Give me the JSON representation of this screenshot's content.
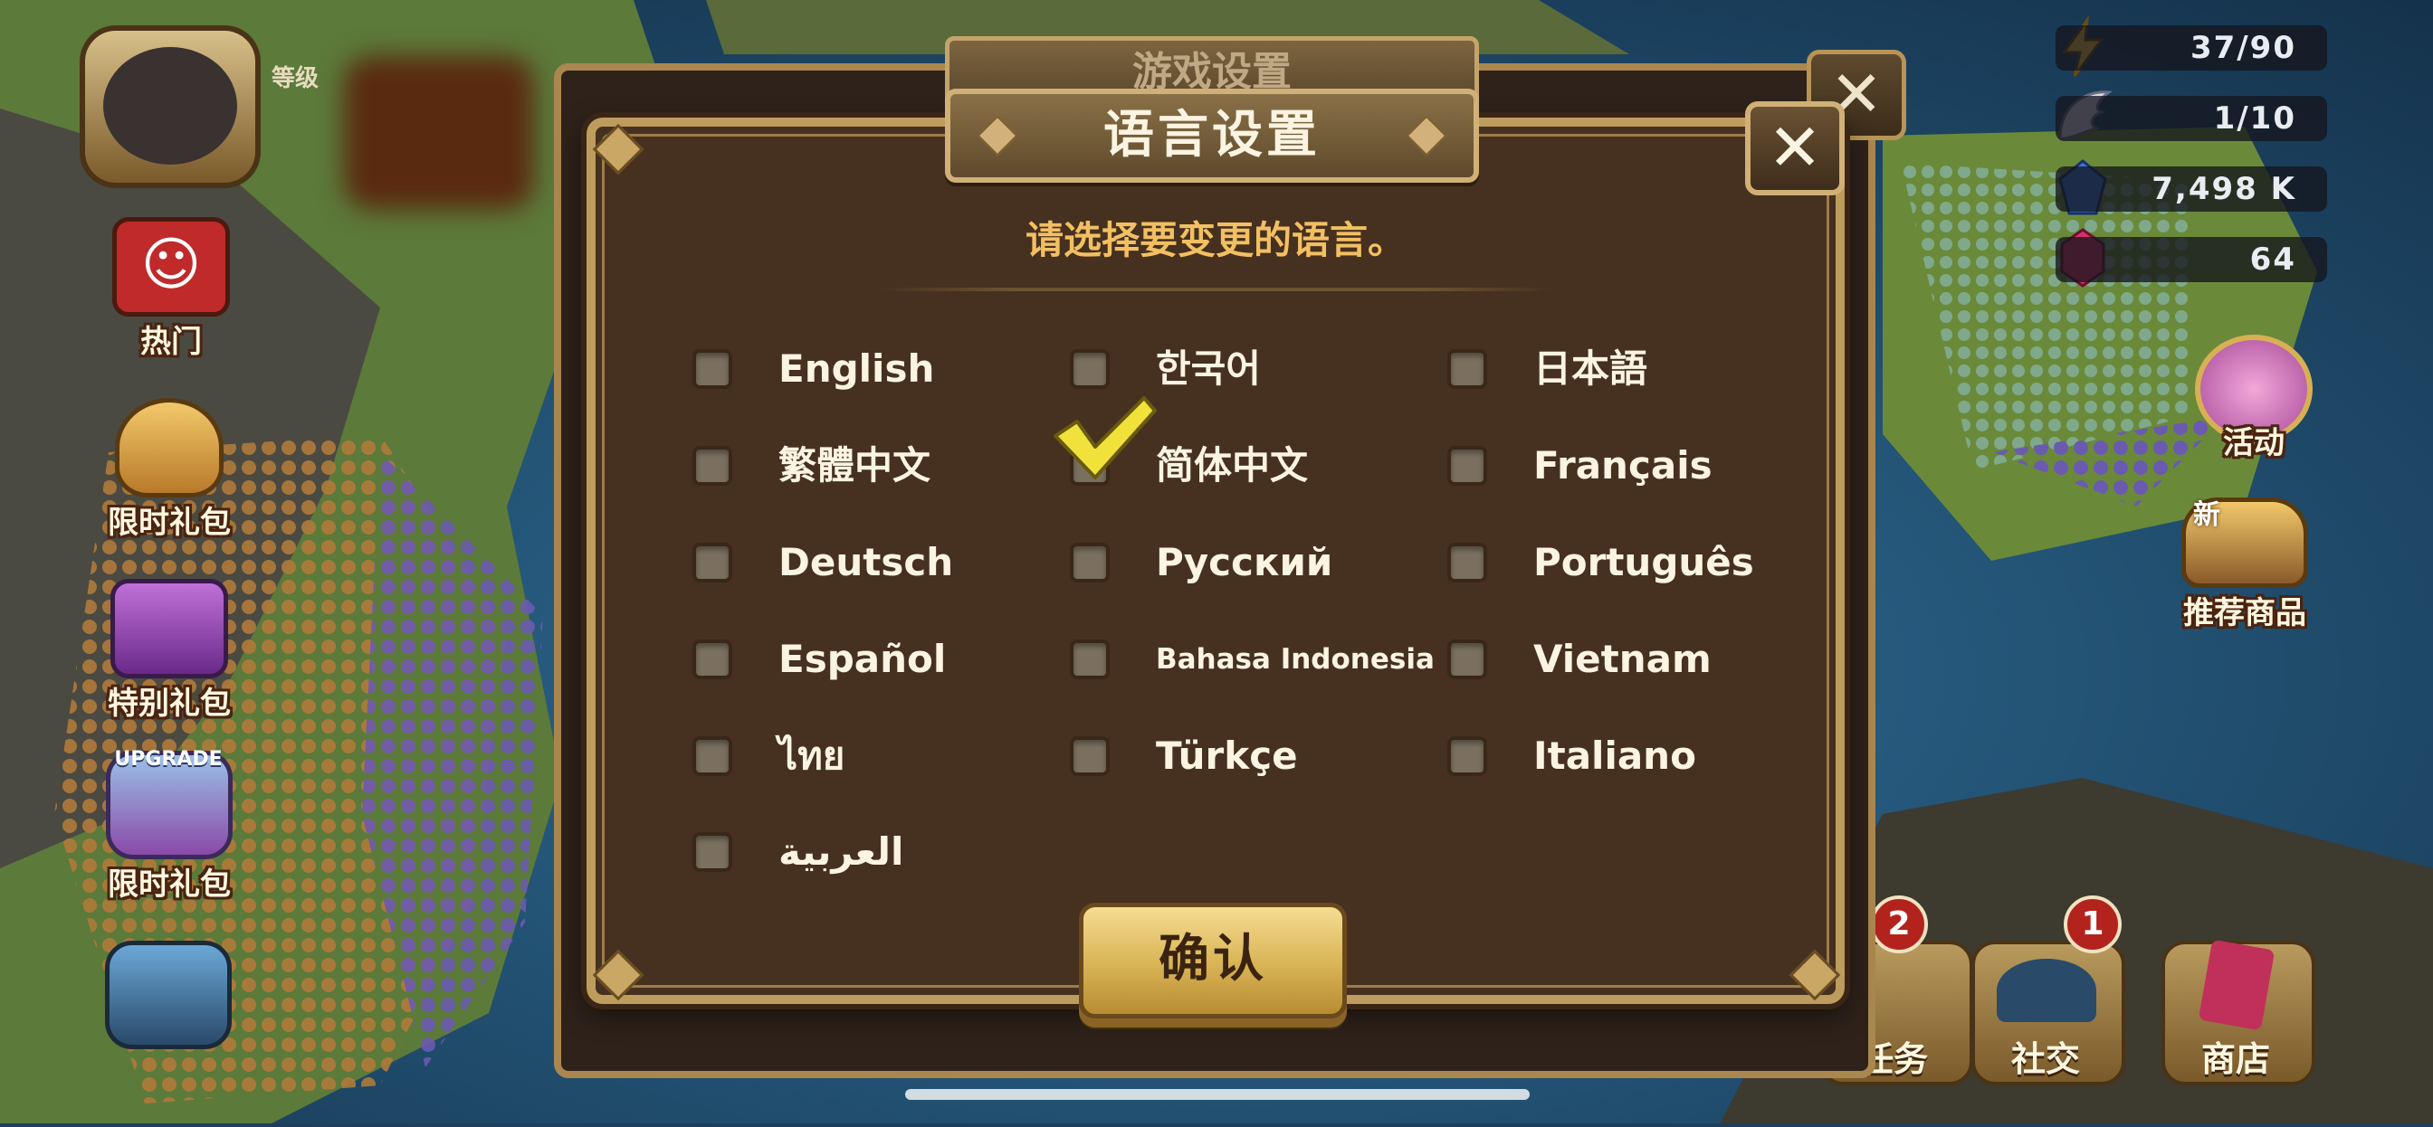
{
  "hud": {
    "energy": "37/90",
    "wings": "1/10",
    "crystals": "7,498 K",
    "gems": "64"
  },
  "profile": {
    "level_label": "等级"
  },
  "left_menu": [
    {
      "label": "热门",
      "icon": "tv-icon"
    },
    {
      "label": "限时礼包",
      "icon": "gift-bag-icon"
    },
    {
      "label": "特别礼包",
      "icon": "special-pack-icon"
    },
    {
      "label": "限时礼包",
      "icon": "upgrade-pack-icon",
      "badge_text": "UPGRADE"
    }
  ],
  "right_menu": [
    {
      "label": "活动",
      "icon": "gift-box-icon"
    },
    {
      "label": "推荐商品",
      "icon": "treasure-icon",
      "tag": "新"
    }
  ],
  "bottom_menu": [
    {
      "label": "任务",
      "badge": "2"
    },
    {
      "label": "社交",
      "badge": "1"
    },
    {
      "label": "商店"
    }
  ],
  "back_dialog": {
    "title": "游戏设置",
    "close": "✕"
  },
  "dialog": {
    "title": "语言设置",
    "close": "✕",
    "prompt": "请选择要变更的语言。",
    "confirm": "确认",
    "selected": "简体中文"
  },
  "languages": [
    [
      "English",
      "한국어",
      "日本語"
    ],
    [
      "繁體中文",
      "简体中文",
      "Français"
    ],
    [
      "Deutsch",
      "Русский",
      "Português"
    ],
    [
      "Español",
      "Bahasa Indonesia",
      "Vietnam"
    ],
    [
      "ไทย",
      "Türkçe",
      "Italiano"
    ],
    [
      "العربية"
    ]
  ],
  "colors": {
    "dialog_bg": "#46301f",
    "frame_gold": "#bd9c5d",
    "prompt_gold": "#f2c062",
    "check_yellow": "#f0e23a"
  }
}
